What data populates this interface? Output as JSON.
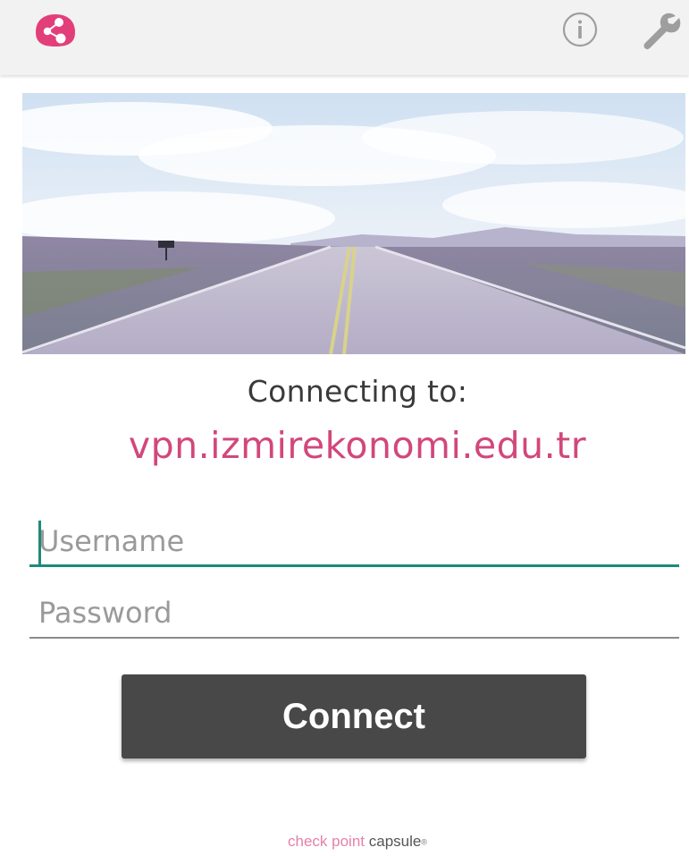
{
  "appbar": {
    "logo_icon": "check-point-capsule-logo-icon",
    "info_icon": "info-icon",
    "settings_icon": "wrench-icon",
    "colors": {
      "background": "#f2f2f2",
      "logo": "#e23e7a",
      "icons": "#9e9e9e"
    }
  },
  "hero": {
    "image": "open-road-landscape"
  },
  "connection": {
    "label": "Connecting to:",
    "server": "vpn.izmirekonomi.edu.tr",
    "server_color": "#d2477b"
  },
  "form": {
    "username": {
      "placeholder": "Username",
      "value": ""
    },
    "password": {
      "placeholder": "Password",
      "value": ""
    },
    "focus_color": "#1f8a7a"
  },
  "actions": {
    "connect_label": "Connect",
    "button_color": "#484848"
  },
  "footer": {
    "brand_part1": "check point",
    "brand_part2": "capsule",
    "registered": "®"
  }
}
